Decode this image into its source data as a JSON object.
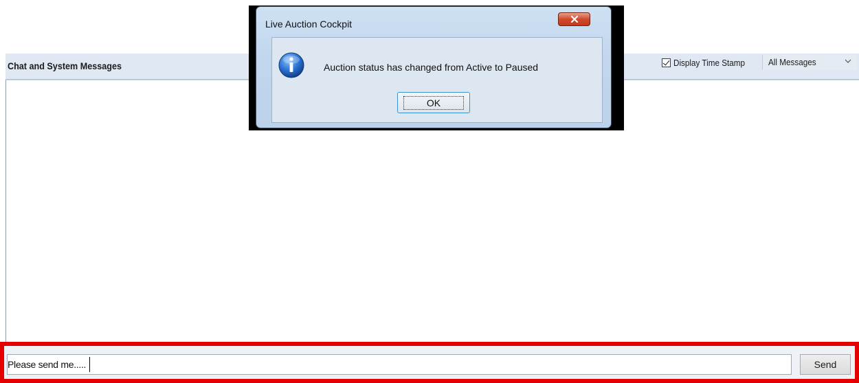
{
  "chat_panel": {
    "title": "Chat and System Messages",
    "timestamp_label": "Display Time Stamp",
    "timestamp_checked": true,
    "filter_selected": "All Messages",
    "messages": []
  },
  "input_bar": {
    "value": "Please send me.....",
    "send_label": "Send",
    "highlight_color": "#e50000"
  },
  "dialog": {
    "title": "Live Auction Cockpit",
    "message": "Auction status has changed from Active to Paused",
    "ok_label": "OK",
    "icon": "info-icon",
    "close_icon": "close-icon"
  },
  "colors": {
    "header_bg": "#dfe8f3",
    "dialog_frame": "#c2d7ee",
    "close_button": "#cf4a2c"
  }
}
